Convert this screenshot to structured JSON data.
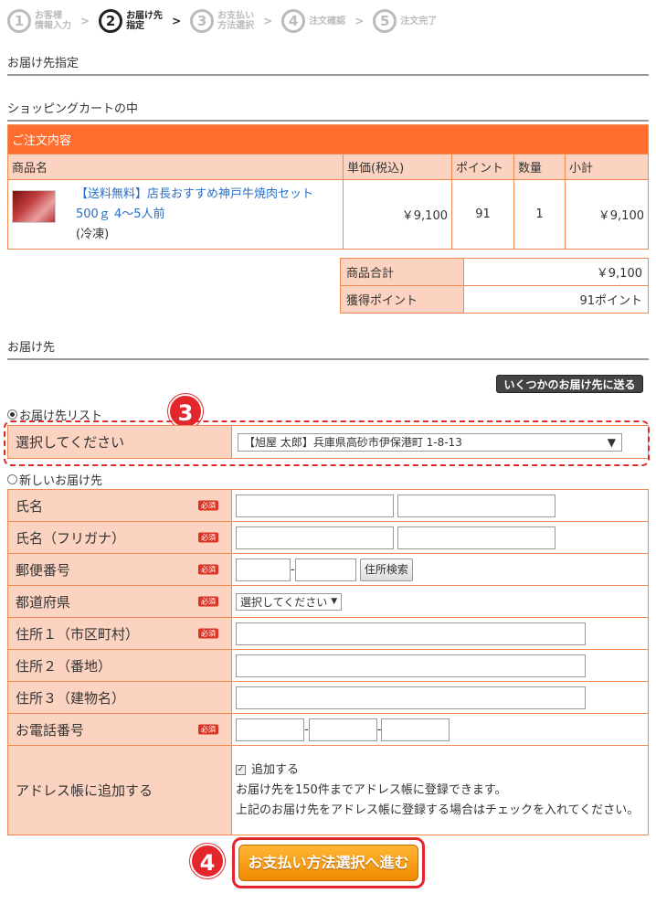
{
  "steps": [
    {
      "num": "1",
      "label": "お客様\n情報入力"
    },
    {
      "num": "2",
      "label": "お届け先\n指定"
    },
    {
      "num": "3",
      "label": "お支払い\n方法選択"
    },
    {
      "num": "4",
      "label": "注文確認"
    },
    {
      "num": "5",
      "label": "注文完了"
    }
  ],
  "sections": {
    "delivery_designation": "お届け先指定",
    "cart": "ショッピングカートの中",
    "delivery": "お届け先"
  },
  "cart": {
    "header": "ご注文内容",
    "columns": [
      "商品名",
      "単価(税込)",
      "ポイント",
      "数量",
      "小計"
    ],
    "items": [
      {
        "name_line1": "【送料無料】店長おすすめ神戸牛焼肉セット",
        "name_line2": "500ｇ 4～5人前",
        "note": "(冷凍)",
        "price": "￥9,100",
        "points": "91",
        "qty": "1",
        "subtotal": "￥9,100"
      }
    ],
    "totals": [
      {
        "label": "商品合計",
        "value": "￥9,100"
      },
      {
        "label": "獲得ポイント",
        "value": "91ポイント"
      }
    ]
  },
  "multi_delivery_button": "いくつかのお届け先に送る",
  "delivery_list": {
    "radio_label": "お届け先リスト",
    "row_label": "選択してください",
    "selected": "【旭屋 太郎】兵庫県高砂市伊保港町 1-8-13"
  },
  "new_delivery": {
    "radio_label": "新しいお届け先",
    "required_label": "必須",
    "fields": {
      "name": "氏名",
      "kana": "氏名（フリガナ）",
      "zip": "郵便番号",
      "pref": "都道府県",
      "addr1": "住所１（市区町村）",
      "addr2": "住所２（番地）",
      "addr3": "住所３（建物名）",
      "tel": "お電話番号",
      "addbook": "アドレス帳に追加する"
    },
    "zip_search_button": "住所検索",
    "pref_placeholder": "選択してください",
    "addbook_check_label": "追加する",
    "addbook_note1": "お届け先を150件までアドレス帳に登録できます。",
    "addbook_note2": "上記のお届け先をアドレス帳に登録する場合はチェックを入れてください。"
  },
  "annotations": {
    "badge3": "3",
    "badge4": "4"
  },
  "proceed_button": "お支払い方法選択へ進む"
}
